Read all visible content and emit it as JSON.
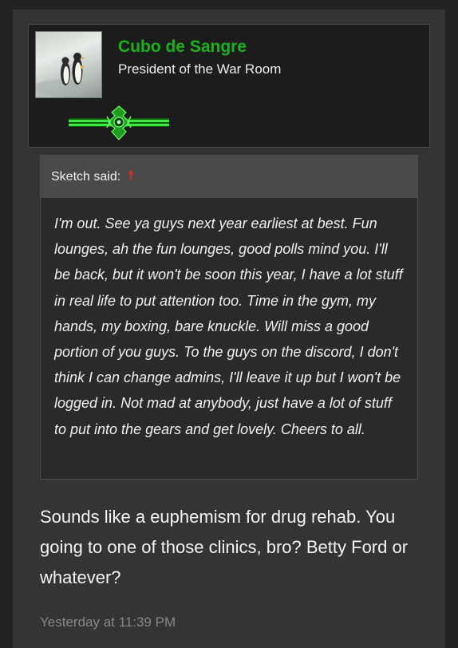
{
  "post": {
    "author": {
      "username": "Cubo de Sangre",
      "user_title": "President of the War Room",
      "avatar_icon": "penguins-avatar",
      "banner_icon": "green-emblem-banner"
    },
    "quote": {
      "author_label": "Sketch said:",
      "jump_icon": "up-arrow-icon",
      "text": "I'm out. See ya guys next year earliest at best. Fun lounges, ah the fun lounges, good polls mind you. I'll be back, but it won't be soon this year, I have a lot stuff in real life to put attention too. Time in the gym, my hands, my boxing, bare knuckle. Will miss a good portion of you guys. To the guys on the discord, I don't think I can change admins, I'll leave it up but I won't be logged in. Not mad at anybody, just have a lot of stuff to put into the gears and get lovely. Cheers to all."
    },
    "body": "Sounds like a euphemism for drug rehab. You going to one of those clinics, bro? Betty Ford or whatever?",
    "timestamp": "Yesterday at 11:39 PM"
  },
  "colors": {
    "page_bg": "#232323",
    "post_bg": "#343434",
    "username": "#18b318",
    "quote_arrow": "#c9302c",
    "timestamp": "#888888"
  }
}
